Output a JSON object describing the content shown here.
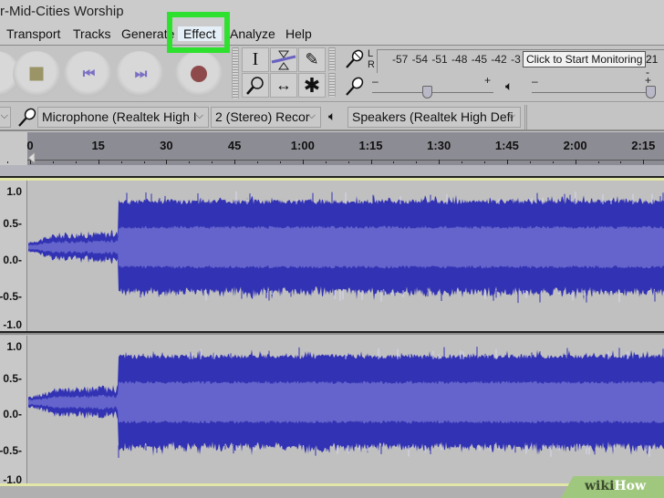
{
  "window": {
    "title": "r-Mid-Cities Worship"
  },
  "menu": {
    "items": [
      {
        "label": "Transport",
        "highlighted": false
      },
      {
        "label": "Tracks",
        "highlighted": false
      },
      {
        "label": "Generate",
        "highlighted": false
      },
      {
        "label": "Effect",
        "highlighted": true
      },
      {
        "label": "Analyze",
        "highlighted": false
      },
      {
        "label": "Help",
        "highlighted": false
      }
    ],
    "highlight_color": "#2ee12e"
  },
  "transport": {
    "buttons": [
      {
        "name": "play",
        "icon": "play-icon"
      },
      {
        "name": "stop",
        "icon": "stop-icon"
      },
      {
        "name": "skip-to-start",
        "icon": "skip-start-icon",
        "glyph": "⏮"
      },
      {
        "name": "skip-to-end",
        "icon": "skip-end-icon",
        "glyph": "⏭"
      },
      {
        "name": "record",
        "icon": "record-icon"
      }
    ]
  },
  "tools": [
    {
      "name": "selection-tool",
      "glyph": "I"
    },
    {
      "name": "envelope-tool",
      "glyph": "⧗"
    },
    {
      "name": "draw-tool",
      "glyph": "✎"
    },
    {
      "name": "zoom-tool",
      "glyph": "⚲"
    },
    {
      "name": "time-shift-tool",
      "glyph": "↔"
    },
    {
      "name": "multi-tool",
      "glyph": "✱"
    }
  ],
  "meter": {
    "channels": [
      "L",
      "R"
    ],
    "scale": "-57 -54 -51 -48 -45 -42 -3",
    "scale_tail": "21 -",
    "tooltip": "Click to Start Monitoring"
  },
  "mixer": {
    "minus": "–",
    "plus": "+",
    "recording_volume": 0.45,
    "playback_volume": 0.98
  },
  "devices": {
    "host_chevron": "⌵",
    "recording_device": "Microphone (Realtek High I",
    "channels": "2 (Stereo) Recor",
    "playback_device": "Speakers (Realtek High Defi",
    "chevron": "⌵"
  },
  "timeline": {
    "labels": [
      "0",
      "15",
      "30",
      "45",
      "1:00",
      "1:15",
      "1:30",
      "1:45",
      "2:00",
      "2:15"
    ]
  },
  "tracks": [
    {
      "channel": "left",
      "scale": [
        "1.0",
        "0.5-",
        "0.0-",
        "-0.5-",
        "-1.0"
      ]
    },
    {
      "channel": "right",
      "scale": [
        "1.0",
        "0.5-",
        "0.0-",
        "-0.5-",
        "-1.0"
      ]
    }
  ],
  "waveform": {
    "color_outer": "#3232b4",
    "color_inner": "#6464cc",
    "intro_end_seconds": 19,
    "intro_peak": 0.2,
    "main_peak": 0.82
  },
  "watermark": {
    "part1": "wiki",
    "part2": "How"
  }
}
